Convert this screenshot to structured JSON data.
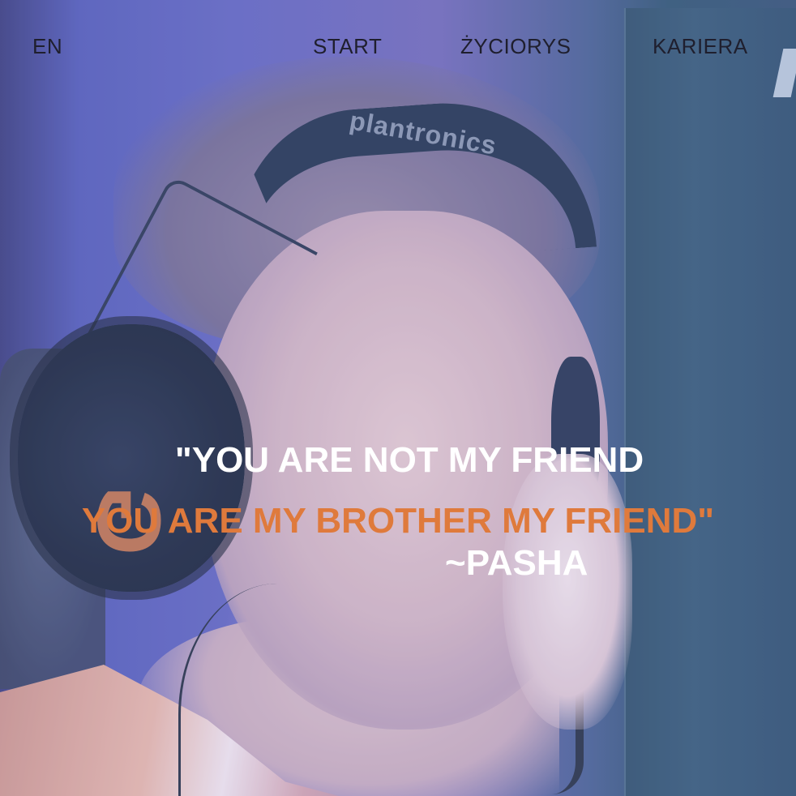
{
  "nav": {
    "language": "EN",
    "items": [
      {
        "label": "START"
      },
      {
        "label": "ŻYCIORYS"
      },
      {
        "label": "KARIERA"
      }
    ]
  },
  "hero": {
    "background_image": "portrait of esports player wearing headset",
    "headset_brand": "plantronics",
    "quote_line1": "\"YOU ARE NOT MY FRIEND",
    "quote_line2": "YOU ARE MY BROTHER MY FRIEND\"",
    "quote_author": "~PASHA"
  },
  "colors": {
    "nav_text": "#1f1f2e",
    "quote_primary": "#ffffff",
    "quote_accent": "#df7a3c"
  }
}
